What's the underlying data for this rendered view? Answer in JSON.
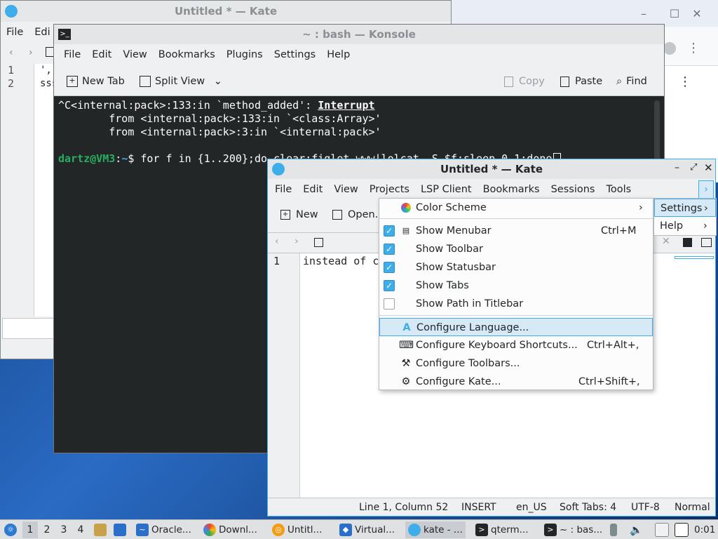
{
  "browser": {
    "controls": [
      "–",
      "☐",
      "✕"
    ],
    "kebab": "⋮"
  },
  "kate_back": {
    "title": "Untitled * — Kate",
    "menu": [
      "File",
      "Edi"
    ],
    "lines": [
      "1",
      "2"
    ],
    "text": [
      "',-.",
      "sss"
    ]
  },
  "konsole": {
    "title": "~ : bash — Konsole",
    "menu": [
      "File",
      "Edit",
      "View",
      "Bookmarks",
      "Plugins",
      "Settings",
      "Help"
    ],
    "toolbar": {
      "new_tab": "New Tab",
      "split_view": "Split View",
      "copy": "Copy",
      "paste": "Paste",
      "find": "Find"
    },
    "term": {
      "l1a": "^C<internal:pack>:133:in `method_added': ",
      "l1b": "Interrupt",
      "l2": "        from <internal:pack>:133:in `<class:Array>'",
      "l3": "        from <internal:pack>:3:in `<internal:pack>'",
      "prompt_user": "dartz@VM3",
      "prompt_colon": ":",
      "prompt_path": "~",
      "prompt_cmd": "$ for f in {1..200};do clear;figlet www|lolcat -S $f;sleep 0.1;done"
    }
  },
  "kate_front": {
    "title": "Untitled * — Kate",
    "menu": [
      "File",
      "Edit",
      "View",
      "Projects",
      "LSP Client",
      "Bookmarks",
      "Sessions",
      "Tools"
    ],
    "toolbar": {
      "new": "New",
      "open": "Open..."
    },
    "line_no": "1",
    "line_text": "instead of cle",
    "status": {
      "pos": "Line 1, Column 52",
      "mode": "INSERT",
      "lang": "en_US",
      "tabs": "Soft Tabs: 4",
      "enc": "UTF-8",
      "hl": "Normal"
    }
  },
  "settings_menu": {
    "color_scheme": "Color Scheme",
    "items": [
      {
        "label": "Show Menubar",
        "shortcut": "Ctrl+M",
        "checked": true
      },
      {
        "label": "Show Toolbar",
        "shortcut": "",
        "checked": true
      },
      {
        "label": "Show Statusbar",
        "shortcut": "",
        "checked": true
      },
      {
        "label": "Show Tabs",
        "shortcut": "",
        "checked": true
      },
      {
        "label": "Show Path in Titlebar",
        "shortcut": "",
        "checked": false
      }
    ],
    "configure": [
      {
        "label": "Configure Language...",
        "shortcut": ""
      },
      {
        "label": "Configure Keyboard Shortcuts...",
        "shortcut": "Ctrl+Alt+,"
      },
      {
        "label": "Configure Toolbars...",
        "shortcut": ""
      },
      {
        "label": "Configure Kate...",
        "shortcut": "Ctrl+Shift+,"
      }
    ]
  },
  "overflow_menu": {
    "settings": "Settings",
    "help": "Help"
  },
  "taskbar": {
    "desktops": [
      "1",
      "2",
      "3",
      "4"
    ],
    "tasks": [
      "Oracle...",
      "Downl...",
      "Untitl...",
      "Virtual...",
      "kate - ...",
      "qterm...",
      "~ : bas..."
    ],
    "clock": "0:01"
  },
  "colors": {
    "accent": "#3daee9",
    "terminal_bg": "#232627",
    "highlight": "#d6e9f7"
  }
}
